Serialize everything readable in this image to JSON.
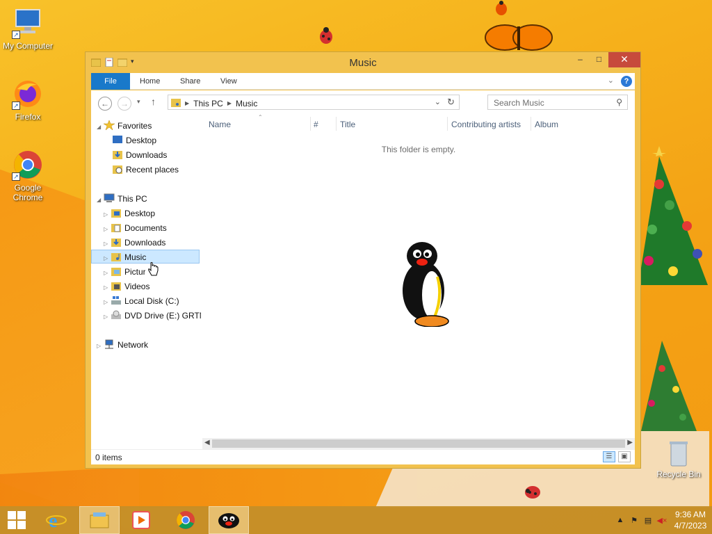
{
  "desktop": {
    "icons": [
      {
        "label": "My Computer"
      },
      {
        "label": "Firefox"
      },
      {
        "label": "Google Chrome"
      },
      {
        "label": "Recycle Bin"
      }
    ]
  },
  "window": {
    "title": "Music",
    "controls": {
      "minimize": "–",
      "maximize": "□",
      "close": "✕"
    }
  },
  "ribbon": {
    "tabs": [
      "File",
      "Home",
      "Share",
      "View"
    ]
  },
  "address": {
    "crumbs": [
      "This PC",
      "Music"
    ],
    "search_placeholder": "Search Music"
  },
  "navpane": {
    "favorites": {
      "label": "Favorites",
      "items": [
        "Desktop",
        "Downloads",
        "Recent places"
      ]
    },
    "this_pc": {
      "label": "This PC",
      "items": [
        "Desktop",
        "Documents",
        "Downloads",
        "Music",
        "Pictures",
        "Videos",
        "Local Disk (C:)",
        "DVD Drive (E:) GRTM"
      ]
    },
    "network": {
      "label": "Network"
    },
    "selected": "Music"
  },
  "content": {
    "columns": [
      "Name",
      "#",
      "Title",
      "Contributing artists",
      "Album"
    ],
    "empty_message": "This folder is empty."
  },
  "status": {
    "count": "0 items"
  },
  "taskbar": {
    "time": "9:36 AM",
    "date": "4/7/2023"
  },
  "colors": {
    "accent": "#1979ca",
    "window_frame": "#f2c24e",
    "close": "#c74a3c",
    "selection": "#cce8ff"
  }
}
